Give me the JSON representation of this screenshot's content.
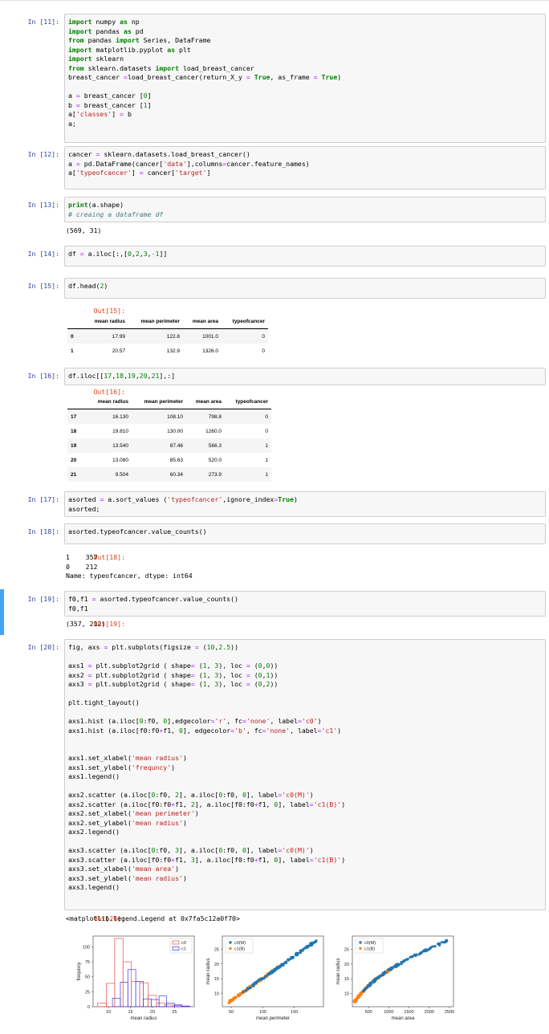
{
  "cells": [
    {
      "prompt": "In [11]:",
      "code": "import numpy as np\nimport pandas as pd\nfrom pandas import Series, DataFrame\nimport matplotlib.pyplot as plt\nimport sklearn\nfrom sklearn.datasets import load_breast_cancer\nbreast_cancer =load_breast_cancer(return_X_y = True, as_frame = True)\n\na = breast_cancer [0]\nb = breast_cancer [1]\na['classes'] = b\na;"
    },
    {
      "prompt": "In [12]:",
      "code": "cancer = sklearn.datasets.load_breast_cancer()\na = pd.DataFrame(cancer['data'],columns=cancer.feature_names)\na['typeofcancer'] = cancer['target']"
    },
    {
      "prompt": "In [13]:",
      "code": "print(a.shape)\n# creaing a dataframe df",
      "output": "(569, 31)"
    },
    {
      "prompt": "In [14]:",
      "code": "df = a.iloc[:,[0,2,3,-1]]"
    },
    {
      "prompt": "In [15]:",
      "code": "df.head(2)",
      "out_prompt": "Out[15]:"
    },
    {
      "prompt": "In [16]:",
      "code": "df.iloc[[17,18,19,20,21],:]",
      "out_prompt": "Out[16]:"
    },
    {
      "prompt": "In [17]:",
      "code": "asorted = a.sort_values ('typeofcancer',ignore_index=True)\nasorted;"
    },
    {
      "prompt": "In [18]:",
      "code": "asorted.typeofcancer.value_counts()",
      "out_prompt": "Out[18]:",
      "output": "1    357\n0    212\nName: typeofcancer, dtype: int64"
    },
    {
      "prompt": "In [19]:",
      "code": "f0,f1 = asorted.typeofcancer.value_counts()\nf0,f1",
      "out_prompt": "Out[19]:",
      "output": "(357, 212)"
    },
    {
      "prompt": "In [20]:",
      "code": "fig, axs = plt.subplots(figsize = (10,2.5))\n\naxs1 = plt.subplot2grid ( shape= (1, 3), loc = (0,0))\naxs2 = plt.subplot2grid ( shape= (1, 3), loc = (0,1))\naxs3 = plt.subplot2grid ( shape= (1, 3), loc = (0,2))\n\nplt.tight_layout()\n\naxs1.hist (a.iloc[0:f0, 0],edgecolor='r', fc='none', label='c0')\naxs1.hist (a.iloc[f0:f0+f1, 0], edgecolor='b', fc='none', label='c1')\n\n\naxs1.set_xlabel('mean radius')\naxs1.set_ylabel('frequncy')\naxs1.legend()\n\naxs2.scatter (a.iloc[0:f0, 2], a.iloc[0:f0, 0], label='c0(M)')\naxs2.scatter (a.iloc[f0:f0+f1, 2], a.iloc[f0:f0+f1, 0], label='c1(B)')\naxs2.set_xlabel('mean perimeter')\naxs2.set_ylabel('mean radius')\naxs2.legend()\n\naxs3.scatter (a.iloc[0:f0, 3], a.iloc[0:f0, 0], label='c0(M)')\naxs3.scatter (a.iloc[f0:f0+f1, 3], a.iloc[f0:f0+f1, 0], label='c1(B)')\naxs3.set_xlabel('mean area')\naxs3.set_ylabel('mean radius')\naxs3.legend()",
      "out_prompt": "Out[20]:",
      "output": "<matplotlib.legend.Legend at 0x7fa5c12a0f70>"
    }
  ],
  "table15": {
    "columns": [
      "",
      "mean radius",
      "mean perimeter",
      "mean area",
      "typeofcancer"
    ],
    "rows": [
      [
        "0",
        "17.99",
        "122.8",
        "1001.0",
        "0"
      ],
      [
        "1",
        "20.57",
        "132.9",
        "1326.0",
        "0"
      ]
    ]
  },
  "table16": {
    "columns": [
      "",
      "mean radius",
      "mean perimeter",
      "mean area",
      "typeofcancer"
    ],
    "rows": [
      [
        "17",
        "16.130",
        "108.10",
        "798.8",
        "0"
      ],
      [
        "18",
        "19.810",
        "130.00",
        "1260.0",
        "0"
      ],
      [
        "19",
        "13.540",
        "87.46",
        "566.3",
        "1"
      ],
      [
        "20",
        "13.080",
        "85.63",
        "520.0",
        "1"
      ],
      [
        "21",
        "9.504",
        "60.34",
        "273.9",
        "1"
      ]
    ]
  },
  "chart_data": [
    {
      "type": "bar",
      "subtype": "histogram-step",
      "xlabel": "mean radius",
      "ylabel": "frequncy",
      "xticks": [
        "10",
        "15",
        "20",
        "25"
      ],
      "yticks": [
        "0",
        "25",
        "50",
        "75",
        "100"
      ],
      "xlim": [
        6.5,
        29.5
      ],
      "ylim": [
        0,
        118
      ],
      "legend": "top-right",
      "series": [
        {
          "name": "c0",
          "color": "#e8534a",
          "bin_edges": [
            7.5,
            9.5,
            11.4,
            13.3,
            15.2,
            17.1,
            19.0,
            20.9,
            22.8,
            24.7,
            26.6,
            28.2
          ],
          "counts": [
            6,
            39,
            114,
            75,
            42,
            40,
            19,
            6,
            3,
            2,
            1
          ]
        },
        {
          "name": "c1",
          "color": "#3a3adf",
          "bin_edges": [
            10.9,
            12.7,
            14.4,
            16.2,
            17.9,
            19.7,
            21.5,
            23.2,
            25.0,
            26.7,
            28.5
          ],
          "counts": [
            14,
            41,
            62,
            42,
            13,
            12,
            18,
            6,
            3,
            1
          ]
        }
      ]
    },
    {
      "type": "scatter",
      "xlabel": "mean perimeter",
      "ylabel": "mean radius",
      "xticks": [
        "50",
        "100",
        "150"
      ],
      "yticks": [
        "10",
        "15",
        "20",
        "25"
      ],
      "xlim": [
        36,
        196
      ],
      "ylim": [
        5.5,
        29.5
      ],
      "legend": "top-left",
      "series": [
        {
          "name": "c0(M)",
          "color": "#1f77b4"
        },
        {
          "name": "c1(B)",
          "color": "#ff7f0e"
        }
      ]
    },
    {
      "type": "scatter",
      "xlabel": "mean area",
      "ylabel": "mean radius",
      "xticks": [
        "500",
        "1000",
        "1500",
        "2000",
        "2500"
      ],
      "yticks": [
        "10",
        "15",
        "20",
        "25"
      ],
      "xlim": [
        100,
        2600
      ],
      "ylim": [
        5.5,
        29.5
      ],
      "legend": "top-left",
      "series": [
        {
          "name": "c0(M)",
          "color": "#1f77b4"
        },
        {
          "name": "c1(B)",
          "color": "#ff7f0e"
        }
      ]
    }
  ]
}
